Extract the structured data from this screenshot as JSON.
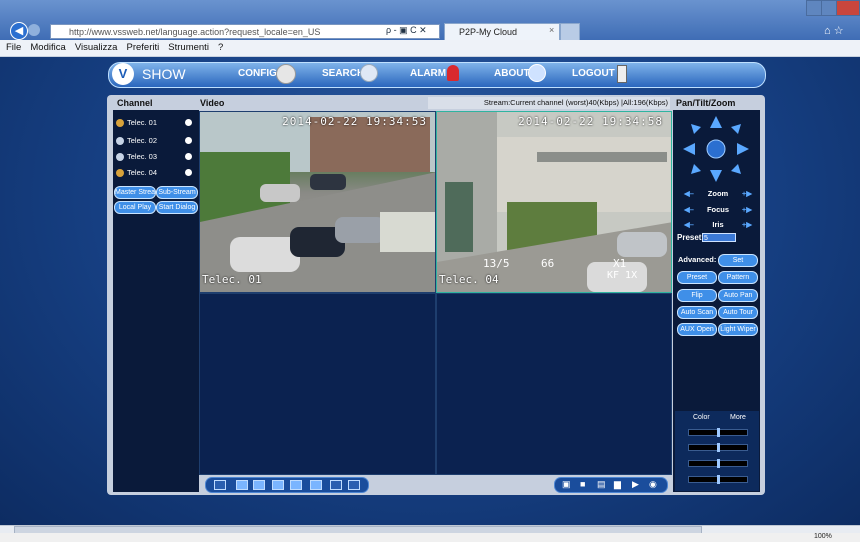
{
  "browser": {
    "address": "http://www.vssweb.net/language.action?request_locale=en_US",
    "tab_title": "P2P-My Cloud",
    "tab_close": "×",
    "addr_icons": "ρ - ▣ C ✕",
    "menu": [
      "File",
      "Modifica",
      "Visualizza",
      "Preferiti",
      "Strumenti",
      "?"
    ],
    "zoom": "100%"
  },
  "app": {
    "logo_text": "SHOW",
    "nav": [
      "CONFIG",
      "SEARCH",
      "ALARM",
      "ABOUT",
      "LOGOUT"
    ]
  },
  "headers": {
    "channel": "Channel",
    "video": "Video",
    "stream_info": "Stream:Current channel (worst)40(Kbps) |All:196(Kbps)",
    "ptz": "Pan/Tilt/Zoom"
  },
  "channels": [
    "Telec. 01",
    "Telec. 02",
    "Telec. 03",
    "Telec. 04"
  ],
  "channel_buttons": [
    "Master Stream",
    "Sub-Stream",
    "Local Play",
    "Start Dialog"
  ],
  "video": {
    "cam1": {
      "timestamp": "2014-02-22 19:34:53",
      "name": "Telec. 01"
    },
    "cam2": {
      "timestamp": "2014-02-22 19:34:58",
      "name": "Telec. 04",
      "overlay1": "13/5",
      "overlay2": "66",
      "overlay3": "X1",
      "overlay4": "KF 1X"
    }
  },
  "ptz": {
    "zoom": "Zoom",
    "focus": "Focus",
    "iris": "Iris",
    "preset_label": "Preset:",
    "preset_value": "5",
    "advanced": "Advanced:",
    "set": "Set",
    "buttons": [
      "Preset",
      "Pattern",
      "Flip",
      "Auto Pan",
      "Auto Scan",
      "Auto Tour",
      "AUX Open",
      "Light Wiper"
    ],
    "tabs": [
      "Color",
      "More"
    ],
    "sliders": [
      0.5,
      0.5,
      0.5,
      0.5
    ]
  },
  "colors": {
    "page_bg": "#163f82",
    "nav_accent": "#2a66bd",
    "button": "#3f8fe8"
  }
}
